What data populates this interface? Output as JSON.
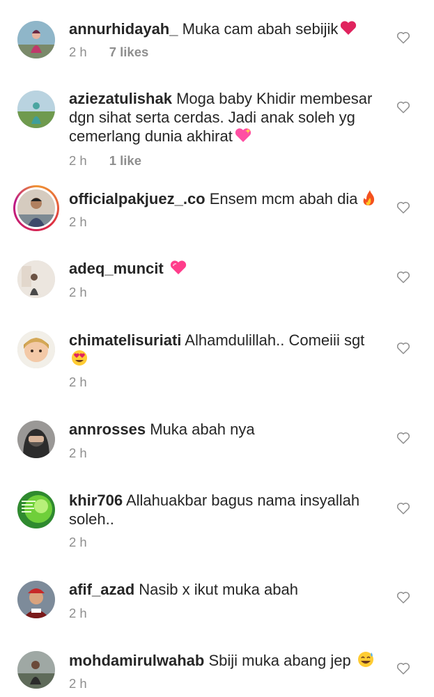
{
  "comments": [
    {
      "username": "annurhidayah_",
      "text": "Muka cam abah sebijik",
      "emoji": "red-heart-emoji",
      "time": "2 h",
      "likes": "7 likes"
    },
    {
      "username": "aziezatulishak",
      "text": "Moga baby Khidir membesar dgn sihat serta cerdas. Jadi anak soleh yg cemerlang dunia akhirat",
      "emoji": "sparkling-heart-emoji",
      "time": "2 h",
      "likes": "1 like"
    },
    {
      "username": "officialpakjuez_.co",
      "text": "Ensem mcm abah dia",
      "emoji": "fire-emoji",
      "time": "2 h",
      "likes": ""
    },
    {
      "username": "adeq_muncit",
      "text": "",
      "emoji": "pink-heart-emoji",
      "time": "2 h",
      "likes": ""
    },
    {
      "username": "chimatelisuriati",
      "text": "Alhamdulillah.. Comeiii sgt",
      "emoji": "heart-eyes-emoji",
      "time": "2 h",
      "likes": ""
    },
    {
      "username": "annrosses",
      "text": "Muka abah nya",
      "emoji": "",
      "time": "2 h",
      "likes": ""
    },
    {
      "username": "khir706",
      "text": "Allahuakbar bagus nama insyallah soleh..",
      "emoji": "",
      "time": "2 h",
      "likes": ""
    },
    {
      "username": "afif_azad",
      "text": "Nasib x ikut muka abah",
      "emoji": "",
      "time": "2 h",
      "likes": ""
    },
    {
      "username": "mohdamirulwahab",
      "text": "Sbiji muka abang jep",
      "emoji": "sweat-smile-emoji",
      "time": "2 h",
      "likes": ""
    }
  ],
  "icons": {
    "like": "heart-outline-icon"
  },
  "colors": {
    "text": "#262626",
    "secondary": "#8e8e8e",
    "heart_red": "#e0245e"
  }
}
